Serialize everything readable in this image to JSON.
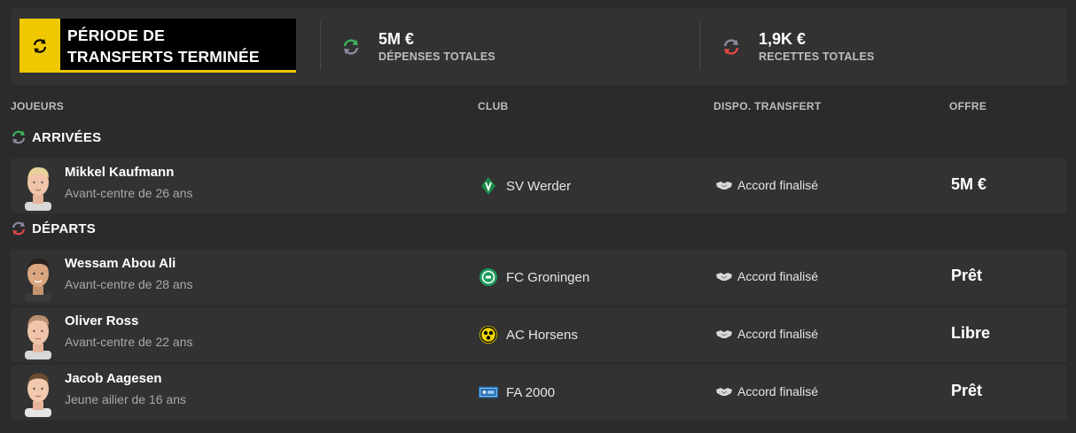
{
  "summary": {
    "period_line1": "PÉRIODE DE",
    "period_line2": "TRANSFERTS TERMINÉE",
    "spend_value": "5M €",
    "spend_label": "DÉPENSES TOTALES",
    "income_value": "1,9K €",
    "income_label": "RECETTES TOTALES",
    "colors": {
      "accent": "#f0c800",
      "arrivals": "#3cb45a",
      "departures": "#e04848"
    }
  },
  "columns": {
    "players": "JOUEURS",
    "club": "CLUB",
    "dispo": "DISPO. TRANSFERT",
    "offer": "OFFRE"
  },
  "arrivals": {
    "title": "ARRIVÉES",
    "icon": "arrivals-icon",
    "rows": [
      {
        "name": "Mikkel Kaufmann",
        "desc": "Avant-centre de 26 ans",
        "club": "SV Werder",
        "crest": "werder-crest-icon",
        "status": "Accord finalisé",
        "offer": "5M €"
      }
    ]
  },
  "departures": {
    "title": "DÉPARTS",
    "icon": "departures-icon",
    "rows": [
      {
        "name": "Wessam Abou Ali",
        "desc": "Avant-centre de 28 ans",
        "club": "FC Groningen",
        "crest": "groningen-crest-icon",
        "status": "Accord finalisé",
        "offer": "Prêt"
      },
      {
        "name": "Oliver Ross",
        "desc": "Avant-centre de 22 ans",
        "club": "AC Horsens",
        "crest": "horsens-crest-icon",
        "status": "Accord finalisé",
        "offer": "Libre"
      },
      {
        "name": "Jacob Aagesen",
        "desc": "Jeune ailier de 16 ans",
        "club": "FA 2000",
        "crest": "fa2000-crest-icon",
        "status": "Accord finalisé",
        "offer": "Prêt"
      }
    ]
  }
}
